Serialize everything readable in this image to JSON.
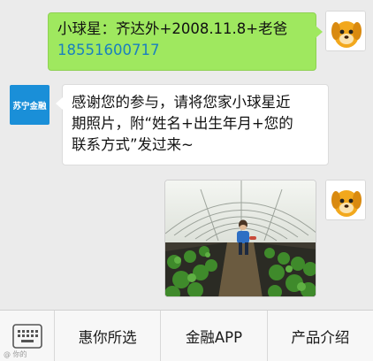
{
  "messages": {
    "outgoing_text": {
      "line1": "小球星：齐达外+2008.11.8+老爸",
      "phone": "18551600717"
    },
    "incoming_text": {
      "sender_logo_label": "苏宁金融",
      "line1": "感谢您的参与，请将您家小球星近",
      "line2": "期照片，附“姓名+出生年月+您的",
      "line3": "联系方式”发过来~"
    }
  },
  "menu": {
    "items": [
      "惠你所选",
      "金融APP",
      "产品介绍"
    ]
  },
  "icons": {
    "avatar": "dog-avatar-icon",
    "keyboard": "keyboard-icon"
  },
  "colors": {
    "outgoing_bubble": "#9fe85f",
    "phone_link": "#1a7fbf",
    "brand_blue": "#1a8fd8"
  },
  "watermark": "@ 你的"
}
